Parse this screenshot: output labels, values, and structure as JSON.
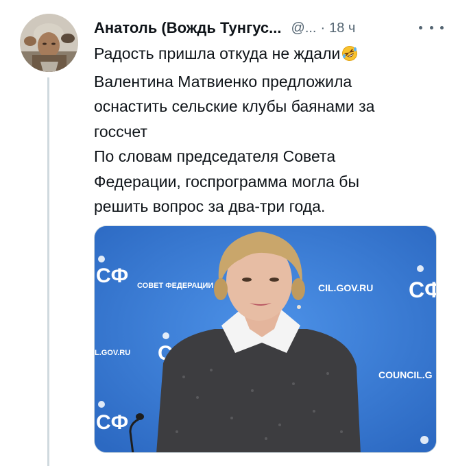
{
  "tweet": {
    "author_name": "Анатоль (Вождь Тунгус...",
    "handle": "@...",
    "separator": "·",
    "time": "18 ч",
    "lines": [
      "Радость пришла откуда не ждали",
      "Валентина Матвиенко предложила",
      "оснастить сельские клубы баянами за",
      "госсчет",
      "По словам председателя Совета",
      "Федерации, госпрограмма могла бы",
      "решить вопрос за два-три года."
    ],
    "emoji": "rolling-on-floor-laughing-emoji"
  },
  "media": {
    "backdrop_texts": [
      "СОВЕТ ФЕДЕРАЦИИ",
      "CIL.GOV.RU",
      "COUNCIL.G",
      "L.GOV.RU",
      "СФ",
      "СФ",
      "СФ",
      "СФ"
    ],
    "colors": {
      "backdrop": "#3b7fd8",
      "backdrop_dark": "#2f6cc4",
      "jacket": "#3c3c3e",
      "collar": "#f4f4f4",
      "hair": "#c9a66b",
      "skin": "#e7bda4"
    }
  },
  "colors": {
    "text": "#0f1419",
    "muted": "#536471",
    "thread": "#cfd9de"
  }
}
